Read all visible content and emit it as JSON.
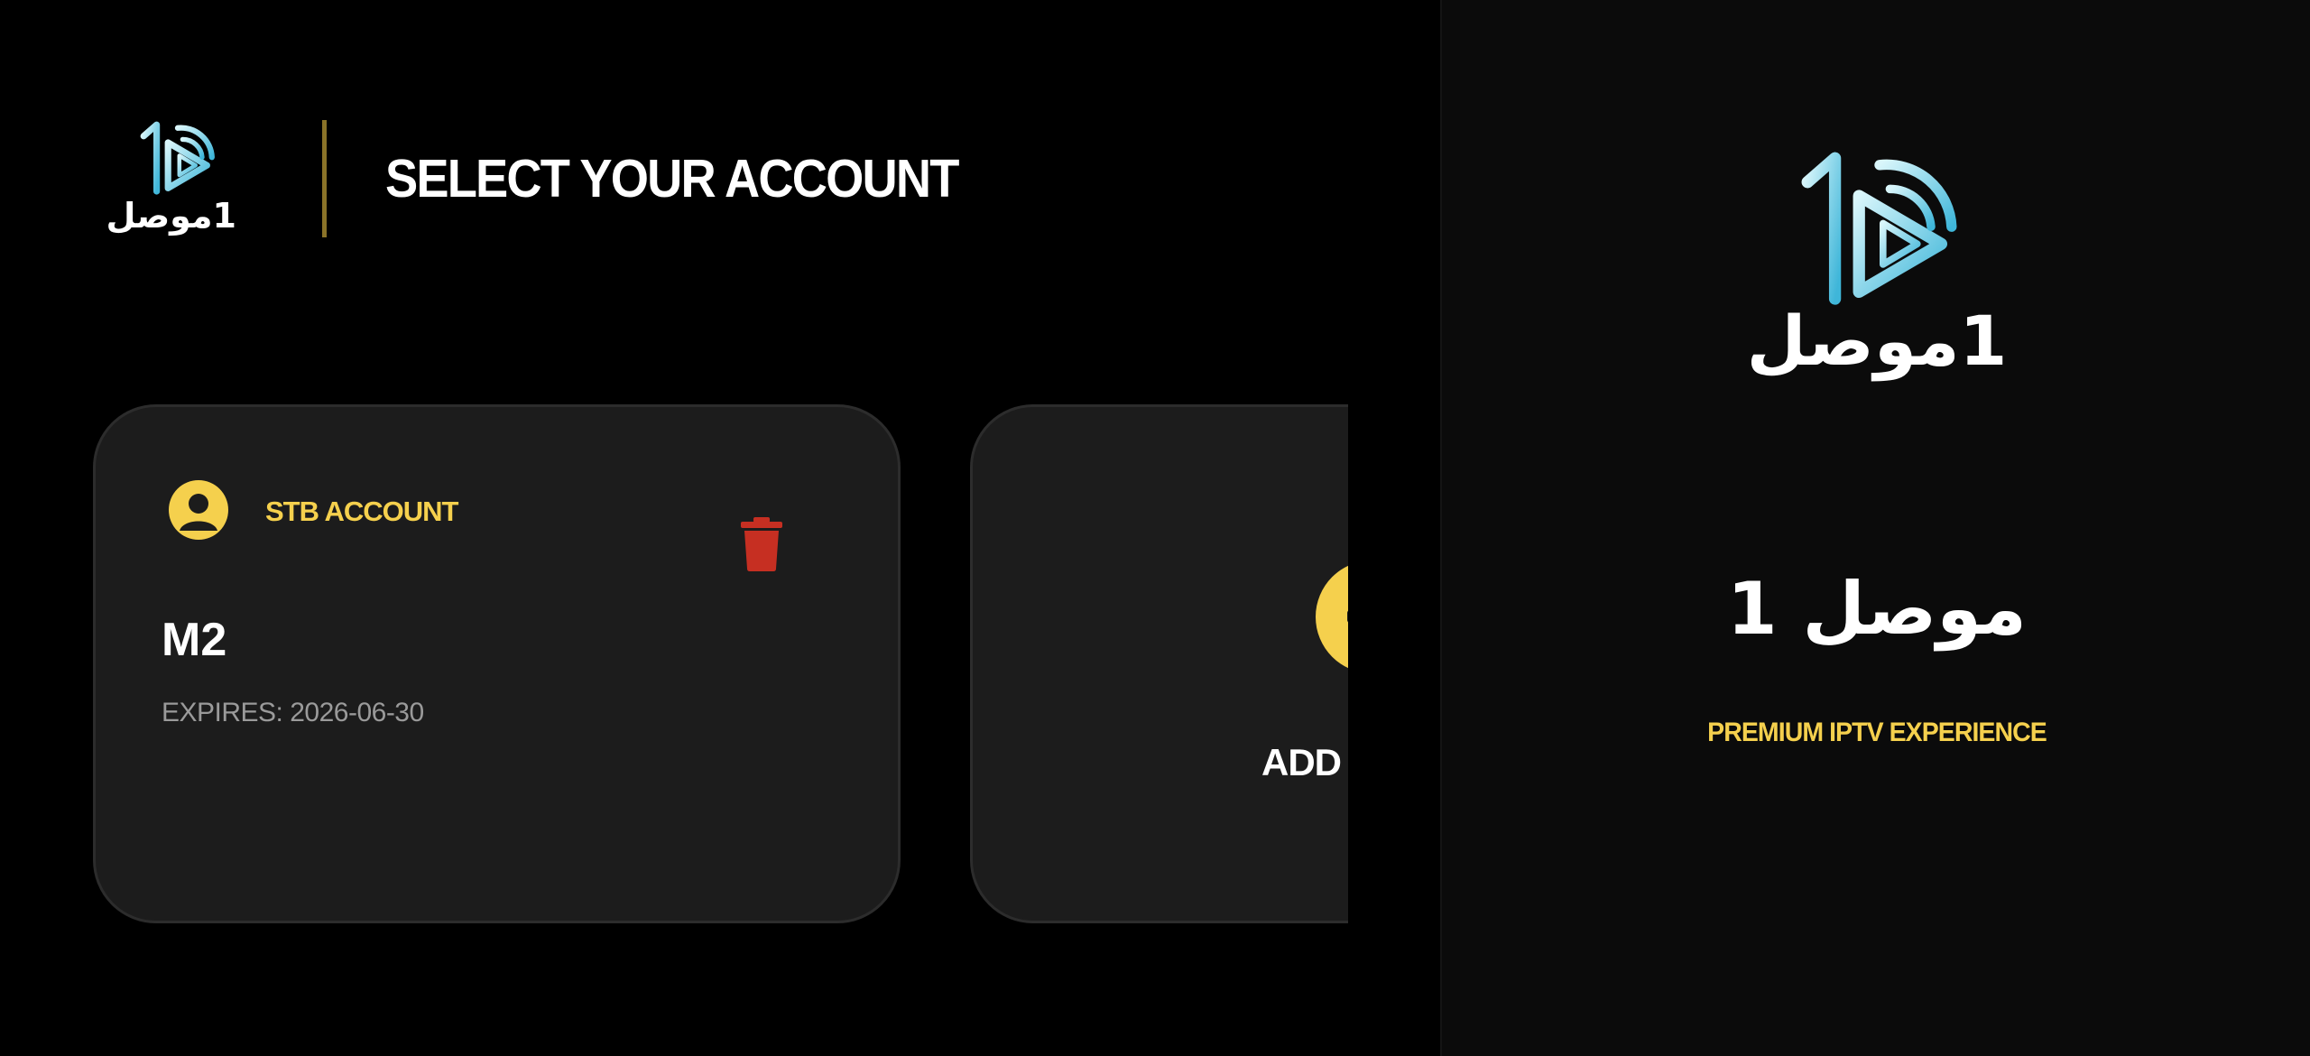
{
  "header": {
    "logo_text": "1موصل",
    "title": "SELECT YOUR ACCOUNT"
  },
  "accounts": [
    {
      "type_label": "STB ACCOUNT",
      "name": "M2",
      "expires": "EXPIRES: 2026-06-30",
      "icons": {
        "avatar": "user-circle-icon",
        "delete": "trash-icon"
      }
    }
  ],
  "add_card": {
    "label": "ADD N",
    "icon": "plus-icon"
  },
  "brand_panel": {
    "logo_text": "1موصل",
    "app_name": "موصل 1",
    "tagline": "PREMIUM IPTV EXPERIENCE"
  },
  "colors": {
    "accent": "#f5d04d",
    "delete": "#c62f22",
    "card_bg": "#1c1c1c",
    "logo_gradient": [
      "#a8ecf5",
      "#3fb6d9"
    ]
  }
}
